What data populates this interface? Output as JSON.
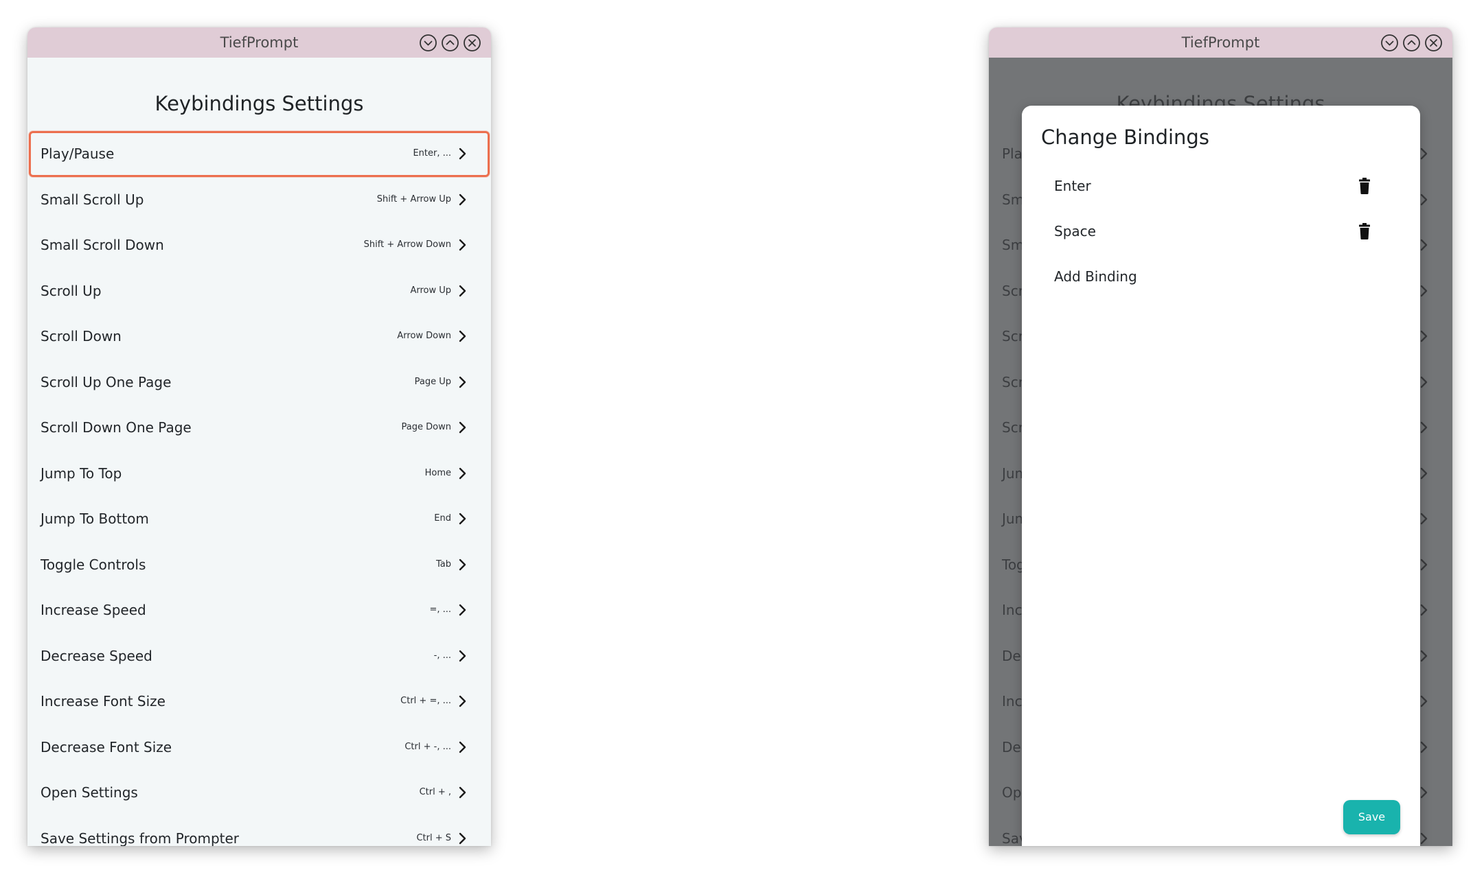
{
  "app_title": "TiefPrompt",
  "settings": {
    "title": "Keybindings Settings",
    "rows": [
      {
        "label": "Play/Pause",
        "value": "Enter, ..."
      },
      {
        "label": "Small Scroll Up",
        "value": "Shift + Arrow Up"
      },
      {
        "label": "Small Scroll Down",
        "value": "Shift + Arrow Down"
      },
      {
        "label": "Scroll Up",
        "value": "Arrow Up"
      },
      {
        "label": "Scroll Down",
        "value": "Arrow Down"
      },
      {
        "label": "Scroll Up One Page",
        "value": "Page Up"
      },
      {
        "label": "Scroll Down One Page",
        "value": "Page Down"
      },
      {
        "label": "Jump To Top",
        "value": "Home"
      },
      {
        "label": "Jump To Bottom",
        "value": "End"
      },
      {
        "label": "Toggle Controls",
        "value": "Tab"
      },
      {
        "label": "Increase Speed",
        "value": "=, ..."
      },
      {
        "label": "Decrease Speed",
        "value": "-, ..."
      },
      {
        "label": "Increase Font Size",
        "value": "Ctrl + =, ..."
      },
      {
        "label": "Decrease Font Size",
        "value": "Ctrl + -, ..."
      },
      {
        "label": "Open Settings",
        "value": "Ctrl + ,"
      },
      {
        "label": "Save Settings from Prompter",
        "value": "Ctrl + S"
      }
    ]
  },
  "dialog": {
    "title": "Change Bindings",
    "bindings": [
      "Enter",
      "Space"
    ],
    "add_label": "Add Binding",
    "save_label": "Save"
  },
  "colors": {
    "titlebar": "#e0ccd6",
    "window_bg": "#f3f7f8",
    "focus_outline": "#ec6f4e",
    "save_button": "#19b3ad",
    "overlay": "#46484a"
  },
  "icons": {
    "window_controls": [
      "minimize-icon",
      "maximize-icon",
      "close-icon"
    ],
    "row_chevron": "chevron-right-icon",
    "delete": "trash-icon"
  }
}
